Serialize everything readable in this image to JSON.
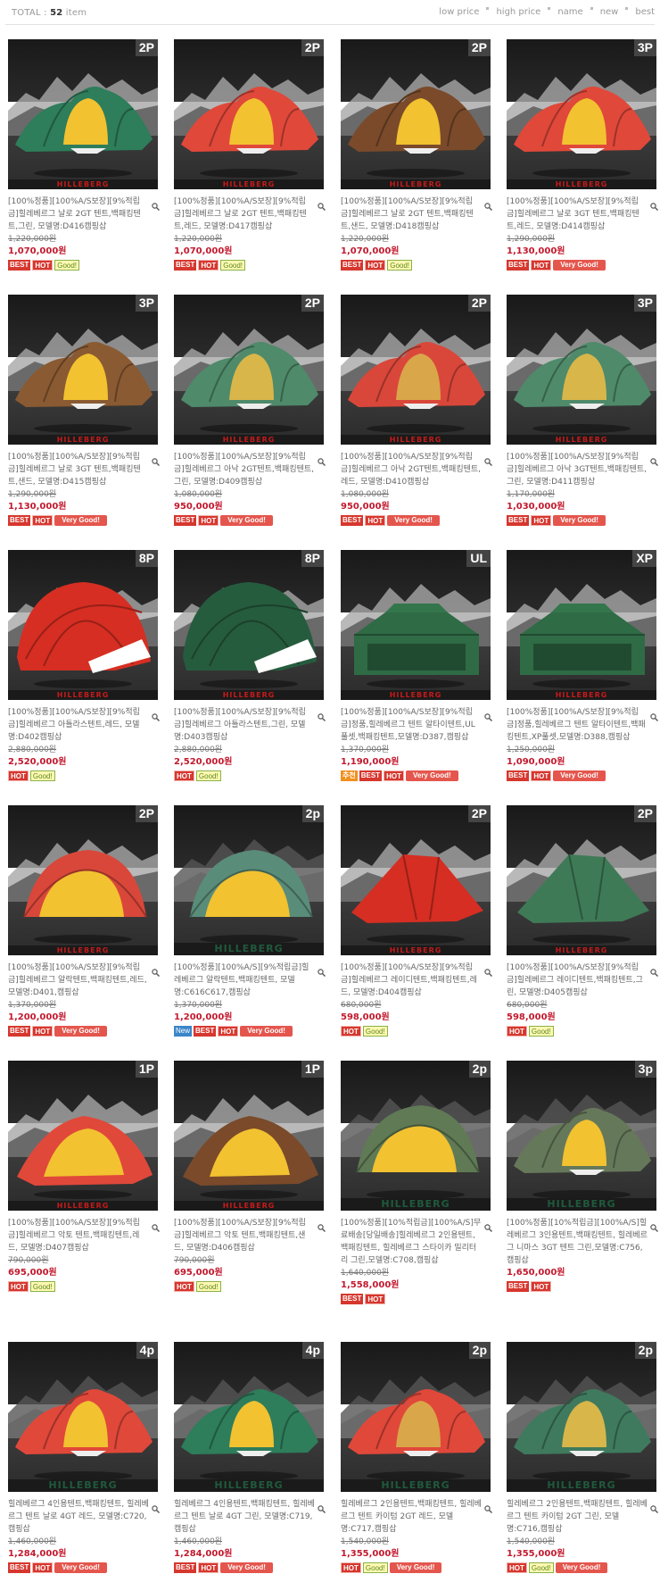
{
  "header": {
    "total_label": "TOTAL :",
    "total_count": "52",
    "total_unit": "item",
    "sort": [
      "low price",
      "high price",
      "name",
      "new",
      "best"
    ]
  },
  "products": [
    {
      "cap": "2P",
      "color": "#2e7d5b",
      "door": "#f2c230",
      "brand": "HILLEBERG",
      "title": "[100%정품][100%A/S보장][9%적립금]힐레베르그 날로 2GT 텐트,백패킹텐트,그린, 모델명:D416캠핑삽",
      "old": "1,220,000원",
      "sale": "1,070,000원",
      "badges": [
        "BEST",
        "HOT",
        "Good!"
      ]
    },
    {
      "cap": "2P",
      "color": "#e0483a",
      "door": "#f2c230",
      "brand": "HILLEBERG",
      "title": "[100%정품][100%A/S보장][9%적립금]힐레베르그 날로 2GT 텐트,백패킹텐트,레드, 모델명:D417캠핑삽",
      "old": "1,220,000원",
      "sale": "1,070,000원",
      "badges": [
        "BEST",
        "HOT",
        "Good!"
      ]
    },
    {
      "cap": "2P",
      "color": "#7a4a2a",
      "door": "#f2c230",
      "brand": "HILLEBERG",
      "title": "[100%정품][100%A/S보장][9%적립금]힐레베르그 날로 2GT 텐트,백패킹텐트,샌드, 모델명:D418캠핑삽",
      "old": "1,220,000원",
      "sale": "1,070,000원",
      "badges": [
        "BEST",
        "HOT",
        "Good!"
      ]
    },
    {
      "cap": "3P",
      "color": "#e0483a",
      "door": "#f2c230",
      "brand": "HILLEBERG",
      "title": "[100%정품][100%A/S보장][9%적립금]힐레베르그 날로 3GT 텐트,백패킹텐트,레드, 모델명:D414캠핑삽",
      "old": "1,290,000원",
      "sale": "1,130,000원",
      "badges": [
        "BEST",
        "HOT",
        "Very Good!"
      ]
    },
    {
      "cap": "3P",
      "color": "#8a5a32",
      "door": "#f2c230",
      "brand": "HILLEBERG",
      "title": "[100%정품][100%A/S보장][9%적립금]힐레베르그 날로 3GT 텐트,백패킹텐트,샌드, 모델명:D415캠핑삽",
      "old": "1,290,000원",
      "sale": "1,130,000원",
      "badges": [
        "BEST",
        "HOT",
        "Very Good!"
      ]
    },
    {
      "cap": "2P",
      "color": "#4f8a6a",
      "door": "#d9b64a",
      "brand": "HILLEBERG",
      "title": "[100%정품][100%A/S보장][9%적립금]힐레베르그 아낙 2GT텐트,백패킹텐트,그린, 모델명:D409캠핑삽",
      "old": "1,080,000원",
      "sale": "950,000원",
      "badges": [
        "BEST",
        "HOT",
        "Very Good!"
      ]
    },
    {
      "cap": "2P",
      "color": "#d9473a",
      "door": "#d9a64a",
      "brand": "HILLEBERG",
      "title": "[100%정품][100%A/S보장][9%적립금]힐레베르그 아낙 2GT텐트,백패킹텐트,레드, 모델명:D410캠핑삽",
      "old": "1,080,000원",
      "sale": "950,000원",
      "badges": [
        "BEST",
        "HOT",
        "Very Good!"
      ]
    },
    {
      "cap": "3P",
      "color": "#4f8a6a",
      "door": "#d9b64a",
      "brand": "HILLEBERG",
      "title": "[100%정품][100%A/S보장][9%적립금]힐레베르그 아낙 3GT텐트,백패킹텐트,그린, 모델명:D411캠핑삽",
      "old": "1,170,000원",
      "sale": "1,030,000원",
      "badges": [
        "BEST",
        "HOT",
        "Very Good!"
      ]
    },
    {
      "cap": "8P",
      "color": "#d62e22",
      "door": "#ffffff",
      "brand": "HILLEBERG",
      "shape": "dome",
      "title": "[100%정품][100%A/S보장][9%적립금]힐레베르그 아틀라스텐트,레드, 모델명:D402캠핑삽",
      "old": "2,880,000원",
      "sale": "2,520,000원",
      "badges": [
        "HOT",
        "Good!"
      ]
    },
    {
      "cap": "8P",
      "color": "#265c3e",
      "door": "#ffffff",
      "brand": "HILLEBERG",
      "shape": "dome",
      "title": "[100%정품][100%A/S보장][9%적립금]힐레베르그 아틀라스텐트,그린, 모델명:D403캠핑삽",
      "old": "2,880,000원",
      "sale": "2,520,000원",
      "badges": [
        "HOT",
        "Good!"
      ]
    },
    {
      "cap": "UL",
      "color": "#2f6b45",
      "door": "#2f6b45",
      "brand": "HILLEBERG",
      "shape": "hut",
      "title": "[100%정품][100%A/S보장][9%적립금]정품,힐레베르그 텐트 알타이텐트,UL 풀셋,백패킹텐트,모델명:D387,캠핑삽",
      "old": "1,370,000원",
      "sale": "1,190,000원",
      "badges": [
        "EVENT",
        "BEST",
        "HOT",
        "Very Good!"
      ]
    },
    {
      "cap": "XP",
      "color": "#2f6b45",
      "door": "#2f6b45",
      "brand": "HILLEBERG",
      "shape": "hut",
      "title": "[100%정품][100%A/S보장][9%적립금]정품,힐레베르그 텐트 알타이텐트,백패킹텐트,XP풀셋,모델명:D388,캠핑삽",
      "old": "1,250,000원",
      "sale": "1,090,000원",
      "badges": [
        "BEST",
        "HOT",
        "Very Good!"
      ]
    },
    {
      "cap": "2P",
      "color": "#d9473a",
      "door": "#f2c230",
      "brand": "HILLEBERG",
      "shape": "dome2",
      "title": "[100%정품][100%A/S보장][9%적립금]힐레베르그 알락텐트,백패킹텐트,레드, 모델명:D401,캠핑삽",
      "old": "1,370,000원",
      "sale": "1,200,000원",
      "badges": [
        "BEST",
        "HOT",
        "Very Good!"
      ]
    },
    {
      "cap": "2p",
      "color": "#5a8c7a",
      "door": "#f2c230",
      "brand": "HILLEBERG",
      "green": true,
      "shape": "dome2",
      "title": "[100%정품][100%A/S][9%적립금]힐레베르그 알락텐트,백패킹텐트, 모델명:C616C617,캠핑삽",
      "old": "1,370,000원",
      "sale": "1,200,000원",
      "badges": [
        "New",
        "BEST",
        "HOT",
        "Very Good!"
      ]
    },
    {
      "cap": "2P",
      "color": "#d62e22",
      "door": "#d62e22",
      "brand": "HILLEBERG",
      "shape": "tarp",
      "title": "[100%정품][100%A/S보장][9%적립금]힐레베르그 레이디텐트,백패킹텐트,레드, 모델명:D404캠핑삽",
      "old": "680,000원",
      "sale": "598,000원",
      "badges": [
        "HOT",
        "Good!"
      ]
    },
    {
      "cap": "2P",
      "color": "#3f7a56",
      "door": "#3f7a56",
      "brand": "HILLEBERG",
      "shape": "tarp",
      "title": "[100%정품][100%A/S보장][9%적립금]힐레베르그 레이디텐트,백패킹텐트,그린, 모델명:D405캠핑삽",
      "old": "680,000원",
      "sale": "598,000원",
      "badges": [
        "HOT",
        "Good!"
      ]
    },
    {
      "cap": "1P",
      "color": "#e0483a",
      "door": "#f2c230",
      "brand": "HILLEBERG",
      "shape": "solo",
      "title": "[100%정품][100%A/S보장][9%적립금]힐레베르그 악토 텐트,백패킹텐트,레드, 모델명:D407캠핑삽",
      "old": "790,000원",
      "sale": "695,000원",
      "badges": [
        "HOT",
        "Good!"
      ]
    },
    {
      "cap": "1P",
      "color": "#7a4a2a",
      "door": "#f2c230",
      "brand": "HILLEBERG",
      "shape": "solo",
      "title": "[100%정품][100%A/S보장][9%적립금]힐레베르그 악토 텐트,백패킹텐트,샌드, 모델명:D406캠핑삽",
      "old": "790,000원",
      "sale": "695,000원",
      "badges": [
        "HOT",
        "Good!"
      ]
    },
    {
      "cap": "2p",
      "color": "#5f7a55",
      "door": "#f2c230",
      "brand": "HILLEBERG",
      "green": true,
      "shape": "dome2",
      "title": "[100%정품][10%적립금][100%A/S]무료배송[당일배송]힐레베르그 2인용텐트,백패킹텐트, 힐레베르그 스타이카 밀리터리 그린,모델명:C708,캠핑삽",
      "old": "1,640,000원",
      "sale": "1,558,000원",
      "badges": [
        "BEST",
        "HOT"
      ]
    },
    {
      "cap": "3p",
      "color": "#66785a",
      "door": "#f2c230",
      "brand": "HILLEBERG",
      "green": true,
      "title": "[100%정품][10%적립금][100%A/S]힐레베르그 3인용텐트,백패킹텐트, 힐레베르그 니마스 3GT 텐트 그린,모델명:C756,캠핑삽",
      "old": "",
      "sale": "1,650,000원",
      "badges": [
        "BEST",
        "HOT"
      ]
    },
    {
      "cap": "4p",
      "color": "#e0483a",
      "door": "#f2c230",
      "brand": "HILLEBERG",
      "green": true,
      "title": "힐레베르그 4인용텐트,백패킹텐트, 힐레베르그 텐트 날로 4GT 레드, 모델명:C720,캠핑삽",
      "old": "1,460,000원",
      "sale": "1,284,000원",
      "badges": [
        "BEST",
        "HOT",
        "Very Good!"
      ]
    },
    {
      "cap": "4p",
      "color": "#2e7d5b",
      "door": "#f2c230",
      "brand": "HILLEBERG",
      "green": true,
      "title": "힐레베르그 4인용텐트,백패킹텐트, 힐레베르그 텐트 날로 4GT 그린, 모델명:C719,캠핑삽",
      "old": "1,460,000원",
      "sale": "1,284,000원",
      "badges": [
        "BEST",
        "HOT",
        "Very Good!"
      ]
    },
    {
      "cap": "2p",
      "color": "#e0483a",
      "door": "#d9a64a",
      "brand": "HILLEBERG",
      "green": true,
      "title": "힐레베르그 2인용텐트,백패킹텐트, 힐레베르그 텐트 카이텀 2GT 레드, 모델명:C717,캠핑삽",
      "old": "1,540,000원",
      "sale": "1,355,000원",
      "badges": [
        "HOT",
        "Good!",
        "Very Good!"
      ]
    },
    {
      "cap": "2p",
      "color": "#3f7a5e",
      "door": "#d9b64a",
      "brand": "HILLEBERG",
      "green": true,
      "title": "힐레베르그 2인용텐트,백패킹텐트, 힐레베르그 텐트 카이텀 2GT 그린, 모델명:C716,캠핑삽",
      "old": "1,540,000원",
      "sale": "1,355,000원",
      "badges": [
        "HOT",
        "Good!",
        "Very Good!"
      ]
    }
  ]
}
